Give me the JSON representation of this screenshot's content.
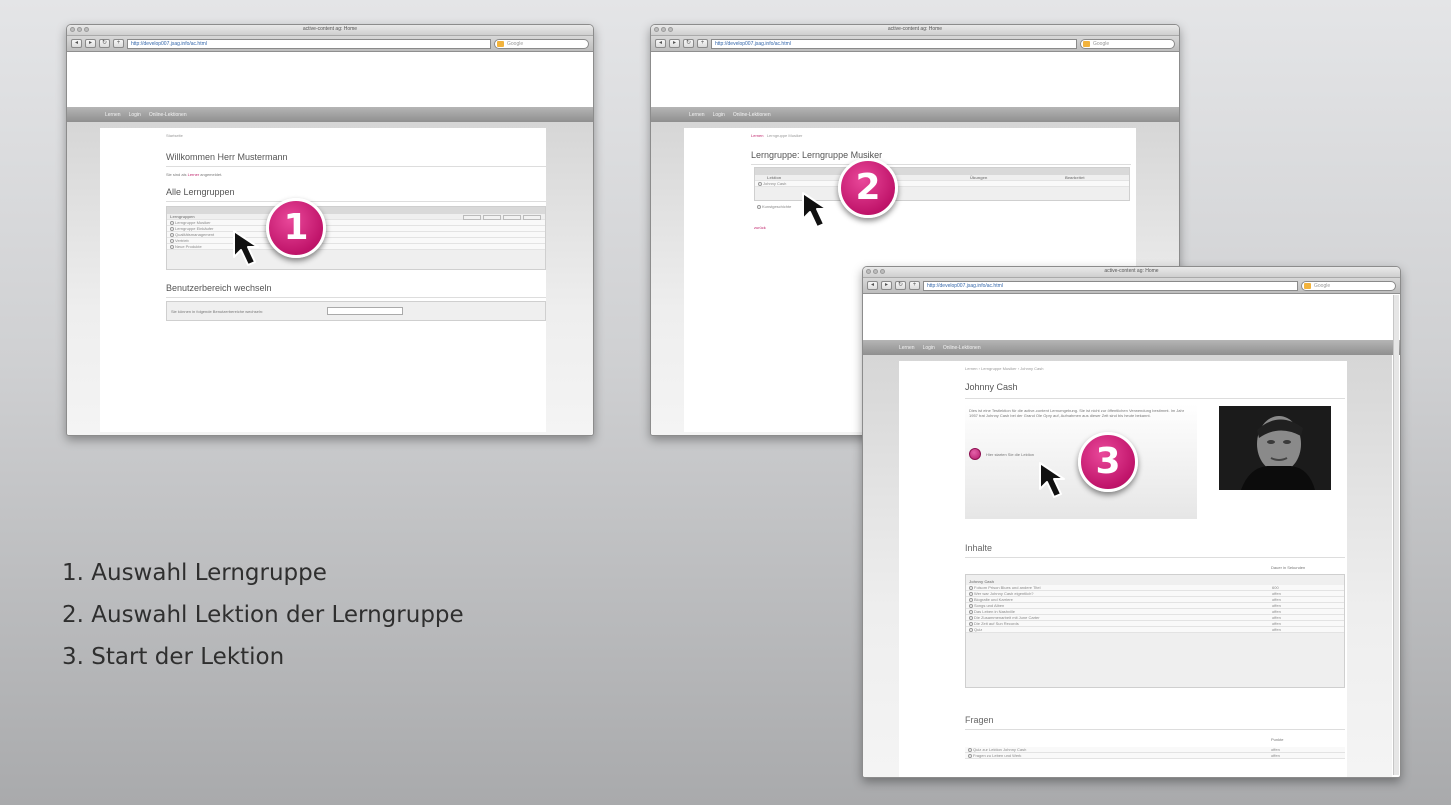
{
  "steps": [
    "1. Auswahl Lerngruppe",
    "2. Auswahl Lektion der Lerngruppe",
    "3. Start der Lektion"
  ],
  "badges": [
    "1",
    "2",
    "3"
  ],
  "browser": {
    "title": "active-content ag: Home",
    "url": "http://develop007.jsag.info/ac.html",
    "search_placeholder": "Google",
    "nav": [
      "Lernen",
      "Login",
      "Online-Lektionen"
    ]
  },
  "screen1": {
    "crumb": "Startseite",
    "welcome": "Willkommen Herr Mustermann",
    "logged_in_pre": "Sie sind als",
    "logged_in_role": "Lerner",
    "logged_in_post": "angemeldet.",
    "groups_heading": "Alle Lerngruppen",
    "table_header": "Lerngruppen",
    "groups": [
      "Lerngruppe Musiker",
      "Lerngruppe Einkäufer",
      "Qualitätsmanagement",
      "Vertrieb",
      "Neue Produkte"
    ],
    "switch_heading": "Benutzerbereich wechseln",
    "switch_text": "Sie können in folgende Benutzerbereiche wechseln:"
  },
  "screen2": {
    "crumb_link": "Lernen",
    "crumb_rest": "Lerngruppe Musiker",
    "heading": "Lerngruppe: Lerngruppe Musiker",
    "columns": [
      "Lektion",
      "Übungen",
      "Bearbeitet"
    ],
    "lessons": [
      "Johnny Cash",
      "Kunstgeschichte"
    ],
    "back": "zurück"
  },
  "screen3": {
    "crumb": "Lernen  ›  Lerngruppe Musiker  ›  Johnny Cash",
    "heading": "Johnny Cash",
    "intro": "Dies ist eine Testlektion für die active-content Lernumgebung. Sie ist nicht zur öffentlichen Verwendung bestimmt. Im Jahr 1957 trat Johnny Cash bei der Grand Ole Opry auf, Aufnahmen aus dieser Zeit sind bis heute bekannt.",
    "start_label": "Hier starten Sie die Lektion",
    "inhalte_heading": "Inhalte",
    "dauer_label": "Dauer in Sekunden",
    "section_title": "Johnny Cash",
    "items": [
      {
        "label": "Folsom Prison Blues und andere Titel",
        "value": "600"
      },
      {
        "label": "Wer war Johnny Cash eigentlich?",
        "value": "offen"
      },
      {
        "label": "Biografie und Karriere",
        "value": "offen"
      },
      {
        "label": "Songs und Alben",
        "value": "offen"
      },
      {
        "label": "Das Leben in Nashville",
        "value": "offen"
      },
      {
        "label": "Die Zusammenarbeit mit June Carter",
        "value": "offen"
      },
      {
        "label": "Die Zeit auf Sun Records",
        "value": "offen"
      },
      {
        "label": "Quiz",
        "value": "offen"
      }
    ],
    "fragen_heading": "Fragen",
    "punkte_label": "Punkte",
    "questions": [
      {
        "label": "Quiz zur Lektion Johnny Cash",
        "value": "offen"
      },
      {
        "label": "Fragen zu Leben und Werk",
        "value": "offen"
      }
    ]
  }
}
